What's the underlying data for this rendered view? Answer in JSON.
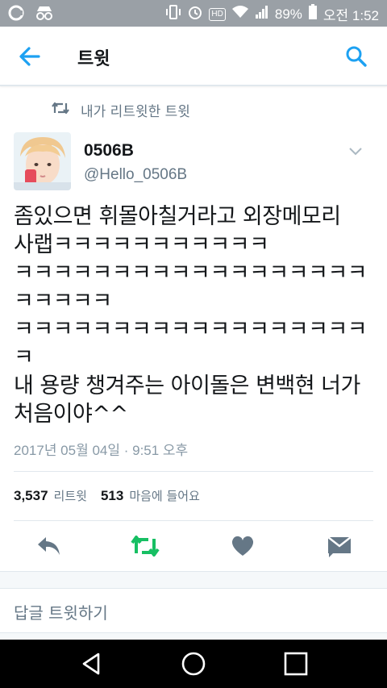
{
  "status_bar": {
    "battery_percent": "89%",
    "time": "오전 1:52",
    "hd_label": "HD"
  },
  "appbar": {
    "title": "트윗"
  },
  "retweet_note": "내가 리트윗한 트윗",
  "author": {
    "name": "0506B",
    "handle": "@Hello_0506B"
  },
  "tweet": {
    "lines": [
      "좀있으면 휘몰아칠거라고 외장메모리",
      "사랩ㅋㅋㅋㅋㅋㅋㅋㅋㅋㅋㅋ",
      "ㅋㅋㅋㅋㅋㅋㅋㅋㅋㅋㅋㅋㅋㅋㅋㅋㅋㅋ",
      "ㅋㅋㅋㅋㅋ",
      "ㅋㅋㅋㅋㅋㅋㅋㅋㅋㅋㅋㅋㅋㅋㅋㅋㅋㅋ",
      "ㅋ",
      "내 용량 챙겨주는 아이돌은 변백현 너가",
      "처음이야^^"
    ],
    "timestamp": "2017년 05월 04일 · 9:51 오후"
  },
  "stats": {
    "retweets_count": "3,537",
    "retweets_label": "리트윗",
    "likes_count": "513",
    "likes_label": "마음에 들어요"
  },
  "colors": {
    "accent": "#1da1f2",
    "retweet_green": "#17bf63",
    "icon_gray": "#657786"
  },
  "reply": {
    "placeholder": "답글 트윗하기"
  },
  "icons": [
    "back-arrow-icon",
    "search-icon",
    "retweet-icon",
    "caret-down-icon",
    "reply-icon",
    "like-heart-icon",
    "direct-message-icon",
    "nav-back-icon",
    "nav-home-icon",
    "nav-recents-icon"
  ]
}
